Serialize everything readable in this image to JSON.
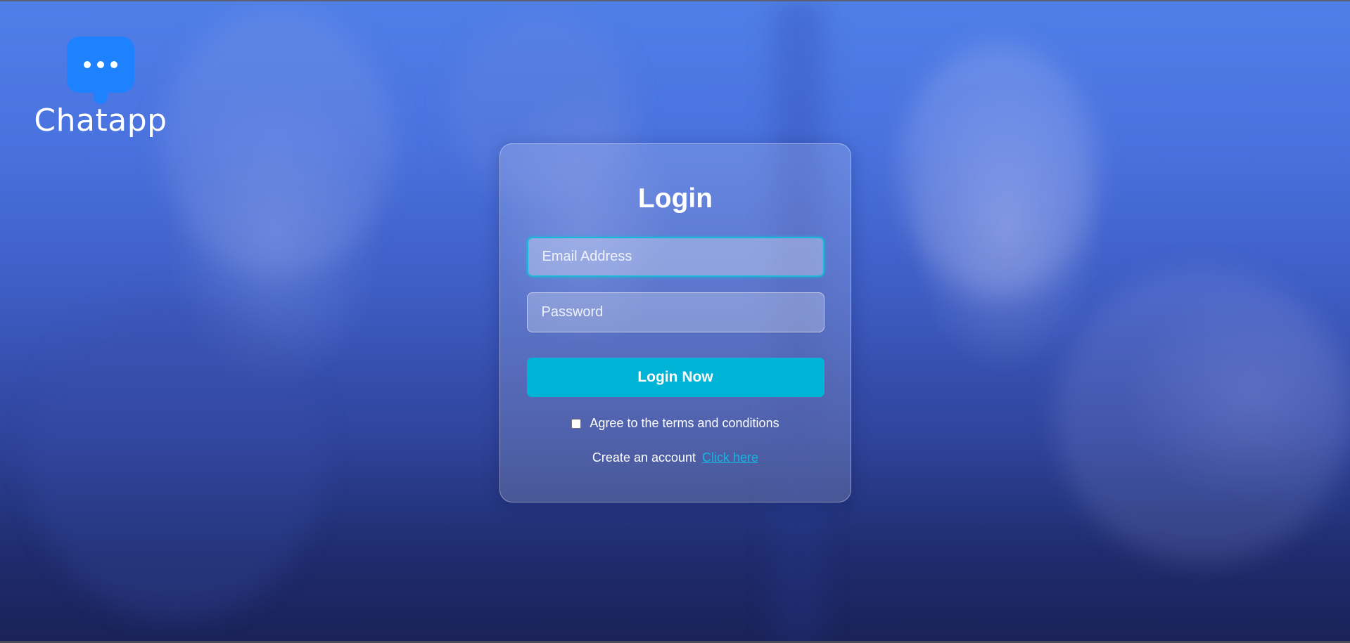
{
  "brand": {
    "name": "Chatapp",
    "logo_icon": "chat-bubble-dots-icon",
    "logo_color": "#1e82ff"
  },
  "login": {
    "title": "Login",
    "email": {
      "placeholder": "Email Address",
      "value": ""
    },
    "password": {
      "placeholder": "Password",
      "value": ""
    },
    "submit_label": "Login Now",
    "terms": {
      "label": "Agree to the terms and conditions",
      "checked": false
    },
    "signup": {
      "prompt": "Create an account",
      "link_label": "Click here"
    }
  },
  "colors": {
    "accent": "#00b4d8",
    "focus_border": "#17b9d9",
    "link": "#16b6e2",
    "background_top": "#4f7fe8",
    "background_bottom": "#1a2258"
  }
}
